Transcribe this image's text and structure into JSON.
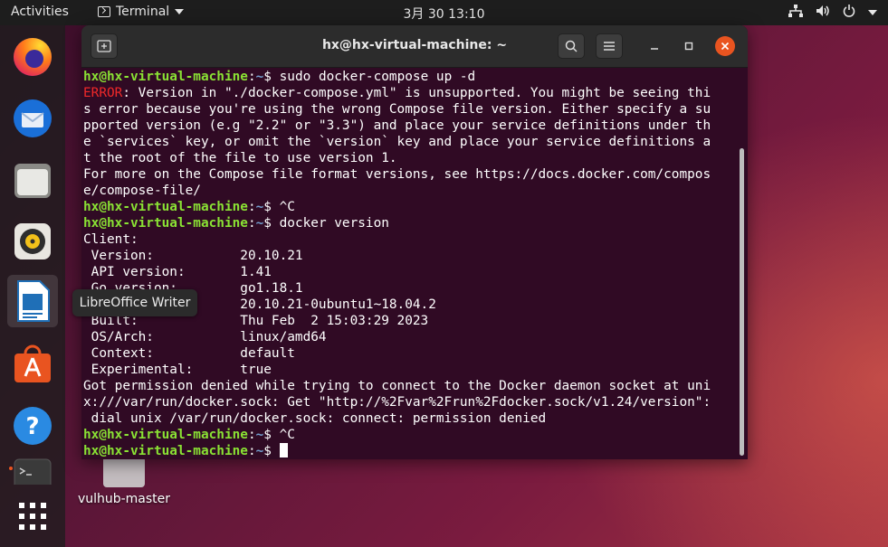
{
  "topbar": {
    "activities": "Activities",
    "app_name": "Terminal",
    "clock": "3月 30  13:10"
  },
  "dock": {
    "items": [
      "firefox",
      "thunderbird",
      "files",
      "rhythmbox",
      "libreoffice-writer",
      "software-center",
      "help",
      "terminal",
      "show-applications"
    ],
    "tooltip": "LibreOffice Writer"
  },
  "desktop": {
    "folder_label": "vulhub-master"
  },
  "window": {
    "title": "hx@hx-virtual-machine: ~"
  },
  "terminal": {
    "prompt_user": "hx@hx-virtual-machine",
    "prompt_path": "~",
    "lines": [
      {
        "type": "cmd",
        "text": "sudo docker-compose up -d"
      },
      {
        "type": "error",
        "label": "ERROR",
        "text": ": Version in \"./docker-compose.yml\" is unsupported. You might be seeing thi"
      },
      {
        "type": "out",
        "text": "s error because you're using the wrong Compose file version. Either specify a su"
      },
      {
        "type": "out",
        "text": "pported version (e.g \"2.2\" or \"3.3\") and place your service definitions under th"
      },
      {
        "type": "out",
        "text": "e `services` key, or omit the `version` key and place your service definitions a"
      },
      {
        "type": "out",
        "text": "t the root of the file to use version 1."
      },
      {
        "type": "out",
        "text": "For more on the Compose file format versions, see https://docs.docker.com/compos"
      },
      {
        "type": "out",
        "text": "e/compose-file/"
      },
      {
        "type": "cmd",
        "text": "^C"
      },
      {
        "type": "cmd",
        "text": "docker version"
      },
      {
        "type": "out",
        "text": "Client:"
      },
      {
        "type": "out",
        "text": " Version:           20.10.21"
      },
      {
        "type": "out",
        "text": " API version:       1.41"
      },
      {
        "type": "out",
        "text": " Go version:        go1.18.1"
      },
      {
        "type": "out",
        "text": " Git commit:        20.10.21-0ubuntu1~18.04.2"
      },
      {
        "type": "out",
        "text": " Built:             Thu Feb  2 15:03:29 2023"
      },
      {
        "type": "out",
        "text": " OS/Arch:           linux/amd64"
      },
      {
        "type": "out",
        "text": " Context:           default"
      },
      {
        "type": "out",
        "text": " Experimental:      true"
      },
      {
        "type": "out",
        "text": "Got permission denied while trying to connect to the Docker daemon socket at uni"
      },
      {
        "type": "out",
        "text": "x:///var/run/docker.sock: Get \"http://%2Fvar%2Frun%2Fdocker.sock/v1.24/version\":"
      },
      {
        "type": "out",
        "text": " dial unix /var/run/docker.sock: connect: permission denied"
      },
      {
        "type": "cmd",
        "text": "^C"
      },
      {
        "type": "cmd",
        "text": "",
        "cursor": true
      }
    ]
  },
  "colors": {
    "terminal_bg": "#300a24",
    "prompt_green": "#8ae234",
    "path_blue": "#729fcf",
    "error_red": "#ef2929",
    "accent": "#e95420"
  }
}
